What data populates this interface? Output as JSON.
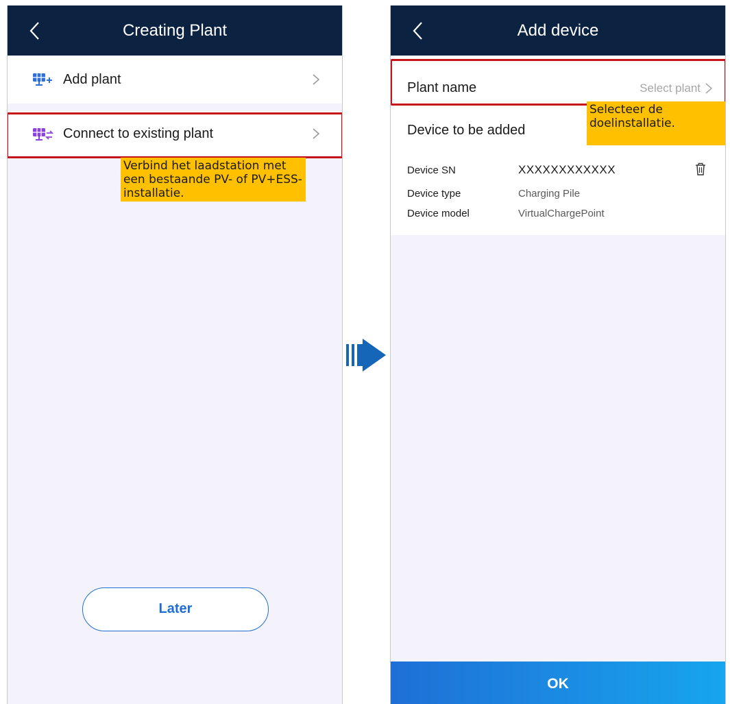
{
  "left_screen": {
    "title": "Creating Plant",
    "options": [
      {
        "label": "Add plant",
        "icon": "add-plant-icon"
      },
      {
        "label": "Connect to existing plant",
        "icon": "connect-plant-icon"
      }
    ],
    "annotation": "Verbind het laadstation met een bestaande PV- of PV+ESS-installatie.",
    "later_label": "Later"
  },
  "right_screen": {
    "title": "Add device",
    "plant_name_label": "Plant name",
    "select_plant_placeholder": "Select plant",
    "annotation": "Selecteer de doelinstallatie.",
    "device_section_title": "Device to be added",
    "device": {
      "sn_label": "Device SN",
      "sn_value": "XXXXXXXXXXXX",
      "type_label": "Device type",
      "type_value": "Charging Pile",
      "model_label": "Device model",
      "model_value": "VirtualChargePoint"
    },
    "ok_label": "OK"
  },
  "colors": {
    "header": "#0b2341",
    "highlight_border": "#c7141b",
    "annotation_bg": "#ffc000",
    "accent_blue": "#1f6ed4",
    "arrow": "#1565b8",
    "background": "#f4f2fb"
  }
}
